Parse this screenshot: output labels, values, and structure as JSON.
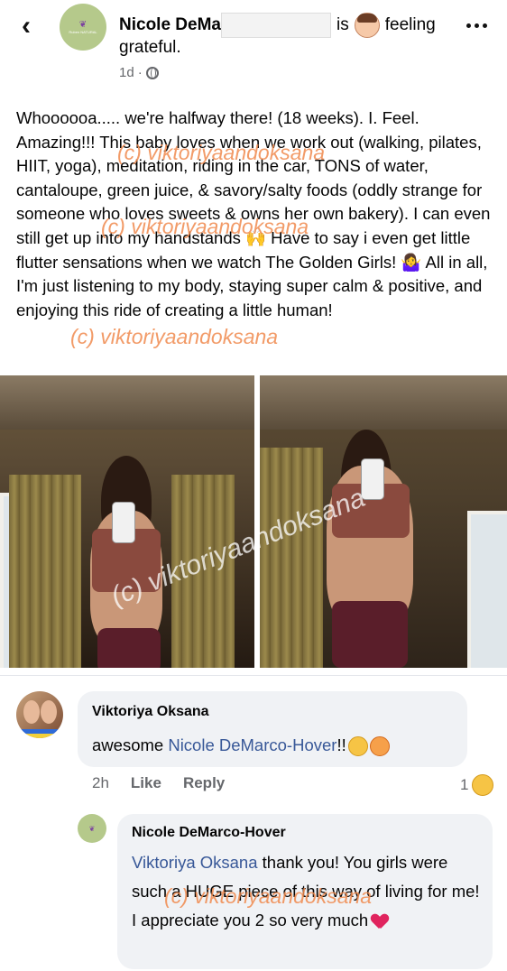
{
  "header": {
    "author_name": "Nicole DeMa",
    "status_prefix": "is",
    "status_text": "feeling",
    "status_text2": "grateful.",
    "timestamp": "1d",
    "dot": "·",
    "page_logo_text": "Ruben NATURAL"
  },
  "post": {
    "paragraphs": [
      "Whoooooa..... we're halfway there! (18 weeks). I. Feel. Amazing!!! This baby loves when we work out (walking, pilates, HIIT, yoga), meditation, riding in the car, TONS of water,  cantaloupe, green juice, & savory/salty foods (oddly strange for someone who loves sweets & owns her own bakery). I can even still get up into my handstands 🙌 Have to say i even get little flutter sensations when we watch The Golden Girls! 🤷‍♀️ All in all, I'm just listening to my body, staying super calm & positive, and enjoying this ride of creating a little human!"
    ],
    "watermark": "(c) viktoriyaandoksana",
    "photo_watermark": "(c) viktoriyaandoksana"
  },
  "comment": {
    "name": "Viktoriya Oksana",
    "text_before": "awesome ",
    "mention": "Nicole DeMarco-Hover",
    "text_after": "!!",
    "time": "2h",
    "like_label": "Like",
    "reply_label": "Reply",
    "reaction_count": "1"
  },
  "reply": {
    "name": "Nicole DeMarco-Hover",
    "mention": "Viktoriya Oksana",
    "text": " thank you! You girls were such a HUGE piece of this way of living for me! I appreciate you 2 so very much"
  }
}
